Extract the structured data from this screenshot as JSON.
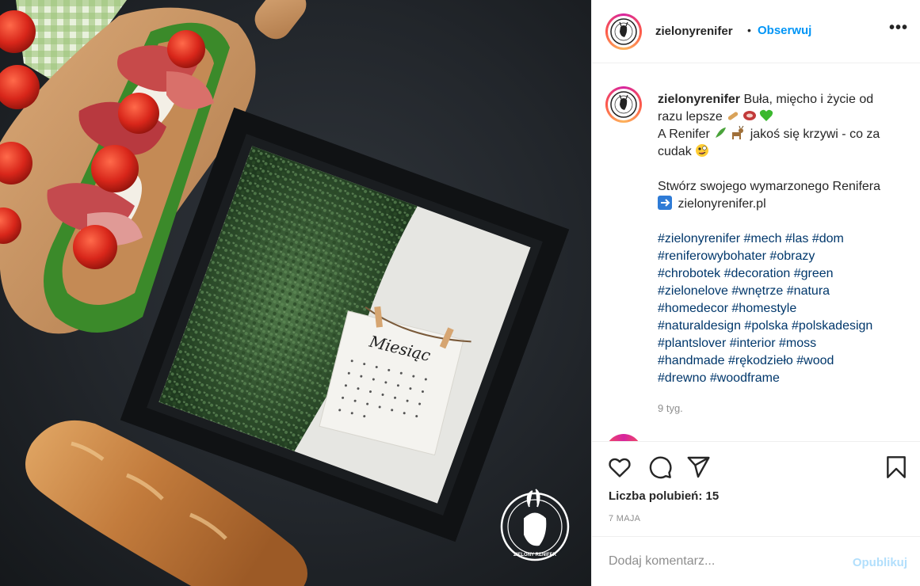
{
  "post": {
    "username": "zielonyrenifer",
    "follow_label": "Obserwuj",
    "more_icon": "more-options-icon",
    "more_label": "•••"
  },
  "photo": {
    "calendar_title": "Miesiąc",
    "logo_text": "ZIELONY RENIFER"
  },
  "caption": {
    "username": "zielonyrenifer",
    "line1": "Buła, mięcho i życie od razu lepsze",
    "line1_emojis": [
      "bread-emoji",
      "meat-emoji",
      "green-heart-emoji"
    ],
    "line2a": "A Renifer",
    "line2_emojis": [
      "herb-emoji",
      "deer-emoji"
    ],
    "line2b": "jakoś się krzywi - co za cudak",
    "line2_end_emoji": "zany-face-emoji",
    "line3a": "Stwórz swojego wymarzonego Renifera",
    "line3_emoji": "right-arrow-emoji",
    "line3b": "zielonyrenifer.pl",
    "hashtags": [
      "#zielonyrenifer",
      "#mech",
      "#las",
      "#dom",
      "#reniferowybohater",
      "#obrazy",
      "#chrobotek",
      "#decoration",
      "#green",
      "#zielonelove",
      "#wnętrze",
      "#natura",
      "#homedecor",
      "#homestyle",
      "#naturaldesign",
      "#polska",
      "#polskadesign",
      "#plantslover",
      "#interior",
      "#moss",
      "#handmade",
      "#rękodzieło",
      "#wood",
      "#drewno",
      "#woodframe"
    ],
    "time_ago": "9 tyg."
  },
  "actions": {
    "like_icon": "heart-icon",
    "comment_icon": "comment-icon",
    "share_icon": "share-icon",
    "save_icon": "bookmark-icon",
    "likes_text": "Liczba polubień: 15",
    "date": "7 MAJA"
  },
  "comment_box": {
    "placeholder": "Dodaj komentarz...",
    "publish_label": "Opublikuj"
  },
  "colors": {
    "accent": "#0095f6",
    "hashtag": "#00376b",
    "muted": "#8e8e8e",
    "publish_disabled": "#b2dffc"
  }
}
